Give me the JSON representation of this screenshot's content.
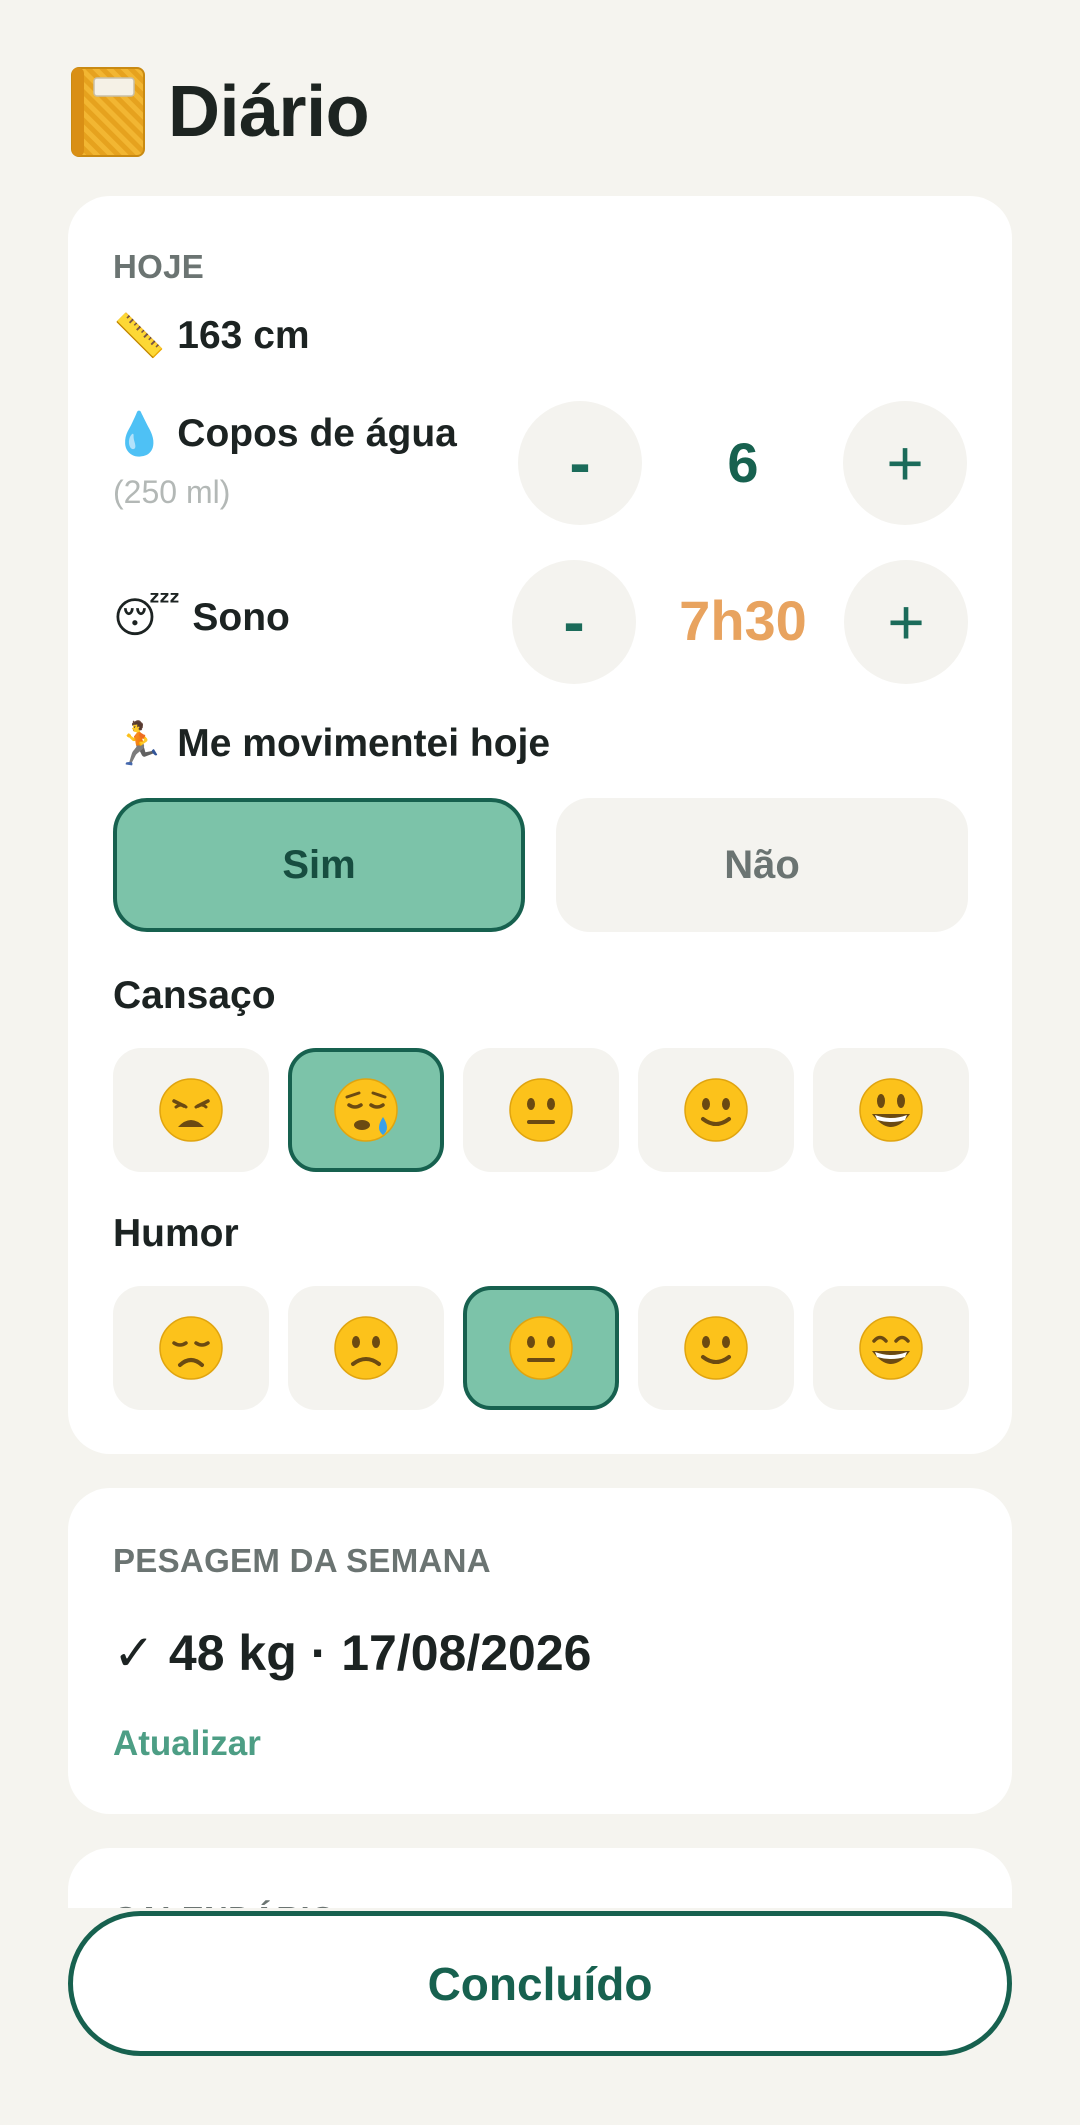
{
  "header": {
    "title": "Diário",
    "icon": "notebook-icon"
  },
  "today": {
    "section_label": "HOJE",
    "height": {
      "icon": "ruler-icon",
      "emoji": "📏",
      "text": "163 cm"
    },
    "water": {
      "icon": "droplet-icon",
      "emoji": "💧",
      "label": "Copos de água",
      "sublabel": "(250 ml)",
      "value": "6",
      "minus": "-",
      "plus": "+"
    },
    "sleep": {
      "icon": "sleeping-face-icon",
      "emoji": "😴",
      "label": "Sono",
      "value": "7h30",
      "minus": "-",
      "plus": "+"
    },
    "movement": {
      "icon": "runner-icon",
      "emoji": "🏃",
      "label": "Me movimentei hoje",
      "yes": "Sim",
      "no": "Não",
      "selected": "Sim"
    },
    "tiredness": {
      "label": "Cansaço",
      "options": [
        "weary-face",
        "sleepy-face",
        "neutral-face",
        "slightly-smiling-face",
        "grinning-face"
      ],
      "selected_index": 1
    },
    "mood": {
      "label": "Humor",
      "options": [
        "disappointed-face",
        "slightly-frowning-face",
        "neutral-face",
        "slightly-smiling-face",
        "grinning-smiling-eyes-face"
      ],
      "selected_index": 2
    }
  },
  "weigh": {
    "section_label": "PESAGEM DA SEMANA",
    "check": "✓",
    "value": "48 kg · 17/08/2026",
    "update_link": "Atualizar"
  },
  "calendar": {
    "section_label": "CALENDÁRIO"
  },
  "footer": {
    "done_label": "Concluído"
  },
  "colors": {
    "accent": "#17614f",
    "selected_bg": "#7cc3a9",
    "sleep_value": "#e8a35f",
    "link": "#4d9e85",
    "background": "#f5f4ef"
  }
}
